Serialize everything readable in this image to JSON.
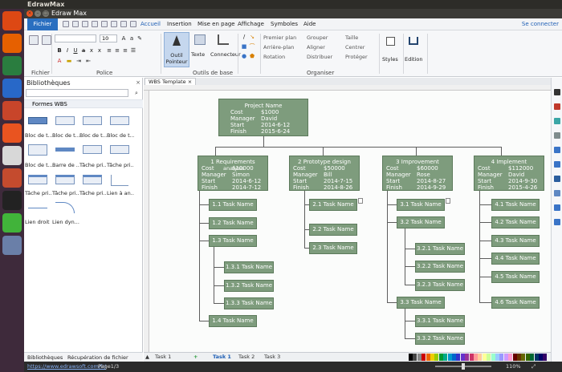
{
  "os": {
    "title": "EdrawMax"
  },
  "window": {
    "title": "Edraw Max",
    "close_glyph": "×",
    "min_glyph": "–",
    "max_glyph": "□"
  },
  "menu": {
    "file": "Fichier",
    "tabs": [
      "Accueil",
      "Insertion",
      "Mise en page",
      "Affichage",
      "Symboles",
      "Aide"
    ],
    "connect": "Se connecter"
  },
  "ribbon": {
    "groups": {
      "fichier": "Fichier",
      "police": "Police",
      "outils_de_base": "Outils de base",
      "organiser": "Organiser"
    },
    "font_size": "10",
    "tools": {
      "pointer": "Outil Pointeur",
      "text": "Texte",
      "connector": "Connecteur"
    },
    "arrange": [
      "Premier plan",
      "Arrière-plan",
      "Rotation",
      "Grouper",
      "Aligner",
      "Distribuer",
      "Taille",
      "Centrer",
      "Protéger"
    ],
    "styles": "Styles",
    "edition": "Edition"
  },
  "sidebar": {
    "title": "Bibliothèques",
    "section": "Formes WBS",
    "shapes": [
      "Bloc de t...",
      "Bloc de t...",
      "Bloc de t...",
      "Bloc de t...",
      "Bloc de t...",
      "Barre de ...",
      "Tâche pri...",
      "Tâche pri...",
      "Tâche pri...",
      "Tâche pri...",
      "Tâche pri...",
      "Lien à an...",
      "Lien droit",
      "Lien dyn..."
    ],
    "tabs": [
      "Bibliothèques",
      "Récupération de fichier"
    ]
  },
  "document": {
    "tab": "WBS Template"
  },
  "wbs": {
    "root": {
      "name": "Project Name",
      "rows": [
        [
          "Cost",
          "$1000"
        ],
        [
          "Manager",
          "David"
        ],
        [
          "Start",
          "2014-6-12"
        ],
        [
          "Finish",
          "2015-6-24"
        ]
      ]
    },
    "phases": [
      {
        "name": "1 Requirements",
        "overlay": "analysis",
        "rows": [
          [
            "Cost",
            "$10000"
          ],
          [
            "Manager",
            "Simon"
          ],
          [
            "Start",
            "2014-6-12"
          ],
          [
            "Finish",
            "2014-7-12"
          ]
        ]
      },
      {
        "name": "2 Prototype design",
        "rows": [
          [
            "Cost",
            "$50000"
          ],
          [
            "Manager",
            "Bill"
          ],
          [
            "Start",
            "2014-7-15"
          ],
          [
            "Finish",
            "2014-8-26"
          ]
        ]
      },
      {
        "name": "3  Improvement",
        "rows": [
          [
            "Cost",
            "$60000"
          ],
          [
            "Manager",
            "Rose"
          ],
          [
            "Start",
            "2014-8-27"
          ],
          [
            "Finish",
            "2014-9-29"
          ]
        ]
      },
      {
        "name": "4 Implement",
        "rows": [
          [
            "Cost",
            "$112000"
          ],
          [
            "Manager",
            "David"
          ],
          [
            "Start",
            "2014-9-30"
          ],
          [
            "Finish",
            "2015-4-26"
          ]
        ]
      }
    ],
    "tasks1": [
      "1.1 Task Name",
      "1.2 Task Name",
      "1.3 Task Name",
      "1.3.1 Task Name",
      "1.3.2 Task Name",
      "1.3.3 Task Name",
      "1.4 Task Name"
    ],
    "tasks2": [
      "2.1 Task Name",
      "2.2 Task Name",
      "2.3 Task Name"
    ],
    "tasks3": [
      "3.1 Task Name",
      "3.2 Task Name",
      "3.2.1 Task Name",
      "3.2.2 Task Name",
      "3.2.3 Task Name",
      "3.3 Task Name",
      "3.3.1 Task Name",
      "3.3.2 Task Name"
    ],
    "tasks4": [
      "4.1 Task Name",
      "4.2 Task Name",
      "4.3 Task Name",
      "4.4 Task Name",
      "4.5 Task Name",
      "4.6 Task Name"
    ]
  },
  "pages": {
    "current_dropdown": "Task 1",
    "tabs": [
      "Task 1",
      "Task 2",
      "Task 3"
    ],
    "add": "+"
  },
  "status": {
    "url": "https://www.edrawsoft.com/fr/",
    "page": "Page1/3",
    "zoom": "110%"
  },
  "colors": {
    "node_fill": "#7e9c7d",
    "node_border": "#5c7a5b",
    "accent": "#2a6fc0"
  }
}
